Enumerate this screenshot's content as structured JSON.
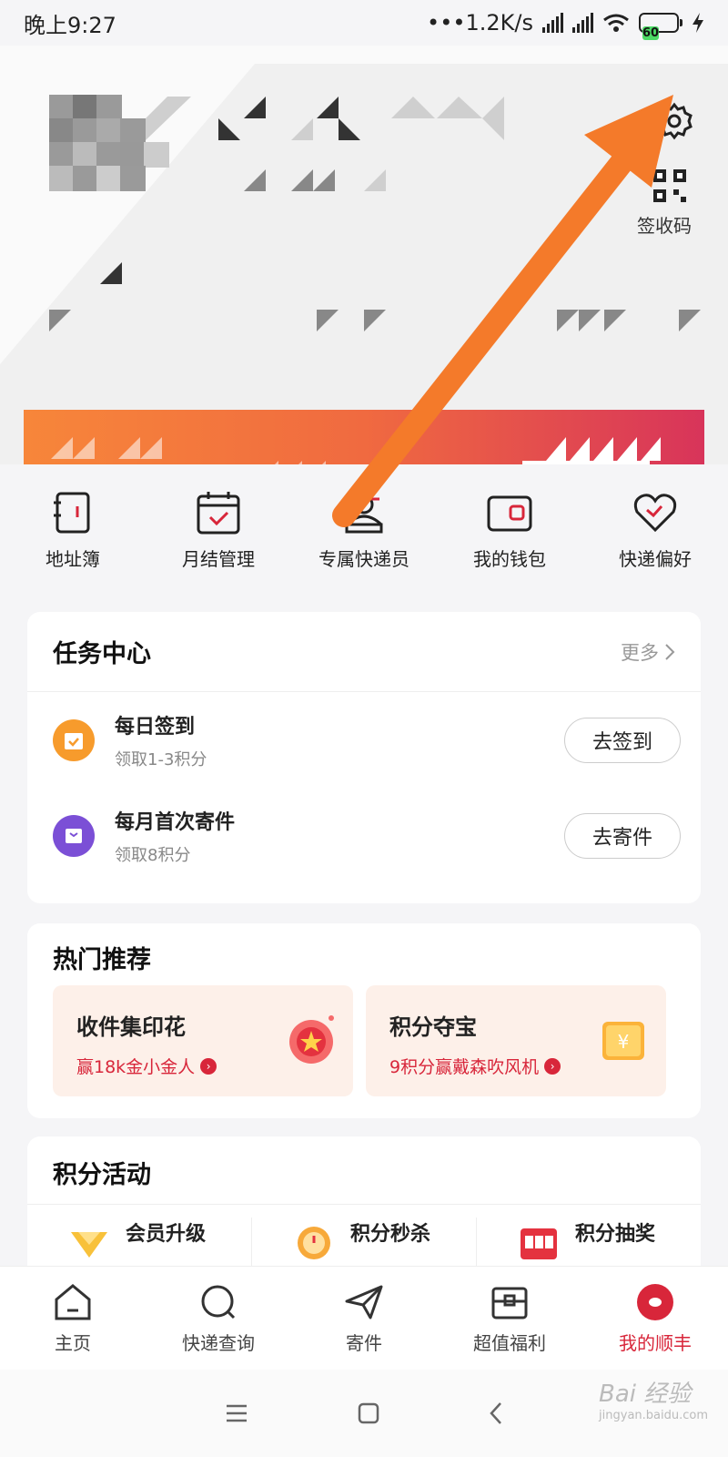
{
  "status_bar": {
    "time": "晚上9:27",
    "network": "•••1.2K/s",
    "battery": "60"
  },
  "header": {
    "qr_label": "签收码"
  },
  "shortcuts": [
    {
      "label": "地址簿",
      "icon": "address-book-icon"
    },
    {
      "label": "月结管理",
      "icon": "calendar-check-icon"
    },
    {
      "label": "专属快递员",
      "icon": "courier-icon"
    },
    {
      "label": "我的钱包",
      "icon": "wallet-icon"
    },
    {
      "label": "快递偏好",
      "icon": "heart-icon"
    }
  ],
  "task_center": {
    "title": "任务中心",
    "more": "更多",
    "tasks": [
      {
        "title": "每日签到",
        "subtitle": "领取1-3积分",
        "button": "去签到",
        "color": "#f79b2c"
      },
      {
        "title": "每月首次寄件",
        "subtitle": "领取8积分",
        "button": "去寄件",
        "color": "#7b4fd6"
      }
    ]
  },
  "hot": {
    "title": "热门推荐",
    "items": [
      {
        "title": "收件集印花",
        "subtitle": "赢18k金小金人"
      },
      {
        "title": "积分夺宝",
        "subtitle": "9积分赢戴森吹风机"
      }
    ]
  },
  "points": {
    "title": "积分活动",
    "items": [
      {
        "label": "会员升级"
      },
      {
        "label": "积分秒杀"
      },
      {
        "label": "积分抽奖"
      }
    ]
  },
  "tabbar": [
    {
      "label": "主页",
      "icon": "home-icon"
    },
    {
      "label": "快递查询",
      "icon": "search-icon"
    },
    {
      "label": "寄件",
      "icon": "send-icon"
    },
    {
      "label": "超值福利",
      "icon": "gift-box-icon"
    },
    {
      "label": "我的顺丰",
      "icon": "profile-icon",
      "active": true
    }
  ],
  "watermark": {
    "main": "Bai 经验",
    "sub": "jingyan.baidu.com"
  },
  "colors": {
    "accent": "#d8263a",
    "arrow": "#f47a2a"
  }
}
